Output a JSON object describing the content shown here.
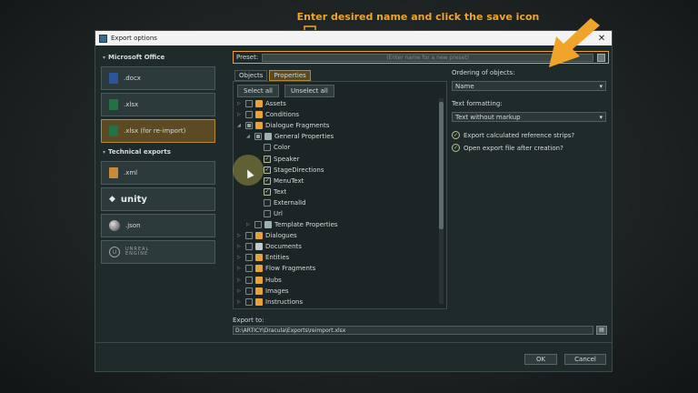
{
  "annotation": {
    "text": "Enter desired name and click the save icon"
  },
  "window": {
    "title": "Export options",
    "close_glyph": "✕"
  },
  "left": {
    "sections": [
      {
        "title": "Microsoft Office",
        "items": [
          {
            "label": ".docx",
            "icon": "word-icon",
            "color": "#2b579a",
            "selected": false
          },
          {
            "label": ".xlsx",
            "icon": "excel-icon",
            "color": "#217346",
            "selected": false
          },
          {
            "label": ".xlsx (for re-import)",
            "icon": "excel-reimport-icon",
            "color": "#217346",
            "selected": true
          }
        ]
      },
      {
        "title": "Technical exports",
        "items": [
          {
            "label": ".xml",
            "icon": "xml-icon",
            "color": "#c98a3a",
            "selected": false
          },
          {
            "label": "unity",
            "icon": "unity-icon",
            "selected": false
          },
          {
            "label": ".json",
            "icon": "json-icon",
            "selected": false
          },
          {
            "label": "UNREAL ENGINE",
            "icon": "unreal-icon",
            "selected": false
          }
        ]
      }
    ]
  },
  "preset": {
    "label": "Preset:",
    "placeholder": "(Enter name for a new preset)"
  },
  "tabs": [
    {
      "label": "Objects",
      "active": false
    },
    {
      "label": "Properties",
      "active": true
    }
  ],
  "tree_buttons": {
    "select_all": "Select all",
    "unselect_all": "Unselect all"
  },
  "tree": [
    {
      "label": "Assets",
      "level": 0,
      "arrow": "▷",
      "state": "unchecked",
      "icon_color": "#e6a33a"
    },
    {
      "label": "Conditions",
      "level": 0,
      "arrow": "▷",
      "state": "unchecked",
      "icon_color": "#e6a33a"
    },
    {
      "label": "Dialogue Fragments",
      "level": 0,
      "arrow": "◢",
      "state": "partial",
      "icon_color": "#e6a33a"
    },
    {
      "label": "General Properties",
      "level": 1,
      "arrow": "◢",
      "state": "partial",
      "icon_color": "#9fb0b0"
    },
    {
      "label": "Color",
      "level": 2,
      "arrow": "",
      "state": "unchecked"
    },
    {
      "label": "Speaker",
      "level": 2,
      "arrow": "",
      "state": "checked"
    },
    {
      "label": "StageDirections",
      "level": 2,
      "arrow": "",
      "state": "checked"
    },
    {
      "label": "MenuText",
      "level": 2,
      "arrow": "",
      "state": "checked"
    },
    {
      "label": "Text",
      "level": 2,
      "arrow": "",
      "state": "checked"
    },
    {
      "label": "ExternalId",
      "level": 2,
      "arrow": "",
      "state": "unchecked"
    },
    {
      "label": "Url",
      "level": 2,
      "arrow": "",
      "state": "unchecked"
    },
    {
      "label": "Template Properties",
      "level": 1,
      "arrow": "▷",
      "state": "unchecked",
      "icon_color": "#9fb0b0"
    },
    {
      "label": "Dialogues",
      "level": 0,
      "arrow": "▷",
      "state": "unchecked",
      "icon_color": "#e6a33a"
    },
    {
      "label": "Documents",
      "level": 0,
      "arrow": "▷",
      "state": "unchecked",
      "icon_color": "#c8c8c8"
    },
    {
      "label": "Entities",
      "level": 0,
      "arrow": "▷",
      "state": "unchecked",
      "icon_color": "#e6a33a"
    },
    {
      "label": "Flow Fragments",
      "level": 0,
      "arrow": "▷",
      "state": "unchecked",
      "icon_color": "#e6a33a"
    },
    {
      "label": "Hubs",
      "level": 0,
      "arrow": "▷",
      "state": "unchecked",
      "icon_color": "#e6a33a"
    },
    {
      "label": "Images",
      "level": 0,
      "arrow": "▷",
      "state": "unchecked",
      "icon_color": "#e6a33a"
    },
    {
      "label": "Instructions",
      "level": 0,
      "arrow": "▷",
      "state": "unchecked",
      "icon_color": "#e6a33a"
    }
  ],
  "right": {
    "ordering_label": "Ordering of objects:",
    "ordering_value": "Name",
    "text_format_label": "Text formatting:",
    "text_format_value": "Text without markup",
    "opt_export_strips": "Export calculated reference strips?",
    "opt_open_after": "Open export file after creation?"
  },
  "export_to": {
    "label": "Export to:",
    "path": "D:\\ARTICY\\Dracula\\Exports\\reimport.xlsx"
  },
  "footer": {
    "ok": "OK",
    "cancel": "Cancel"
  },
  "colors": {
    "accent": "#e8a238",
    "selected_bg": "#5b4a22"
  }
}
